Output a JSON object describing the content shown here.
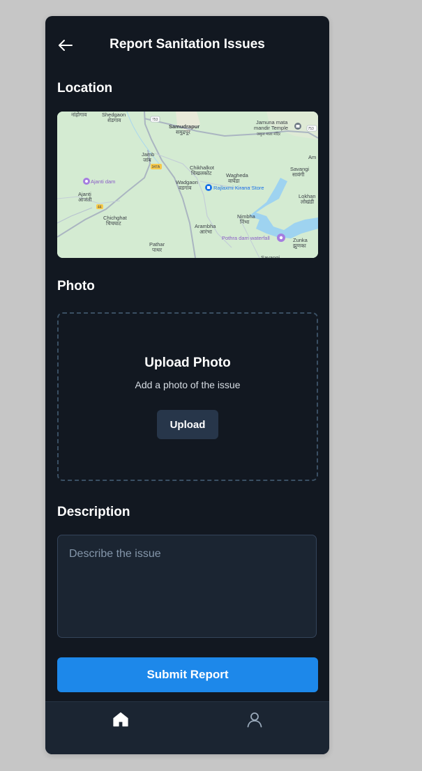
{
  "header": {
    "title": "Report Sanitation Issues",
    "back_icon": "arrow-left-icon"
  },
  "location": {
    "label": "Location",
    "map": {
      "places": [
        {
          "name": "Shedgaon",
          "local": "शेडगाव"
        },
        {
          "name": "Samudrapur",
          "local": "समुद्रपूर"
        },
        {
          "name": "Jamuna mata mandir Temple",
          "local": "जमुना माता मंदिर"
        },
        {
          "name": "Jamb",
          "local": "जांब"
        },
        {
          "name": "Ajanti dam"
        },
        {
          "name": "Ajanti",
          "local": "आजंती"
        },
        {
          "name": "Chikhalkot",
          "local": "चिखलकोट"
        },
        {
          "name": "Wagheda",
          "local": "वाघेडा"
        },
        {
          "name": "Wadgaon",
          "local": "वडगाव"
        },
        {
          "name": "Rajlaxmi Kirana Store"
        },
        {
          "name": "Savangi",
          "local": "सावंगी"
        },
        {
          "name": "Lokhan",
          "local": "लोखंडी"
        },
        {
          "name": "Chichghat",
          "local": "चिचघाट"
        },
        {
          "name": "Nimbha",
          "local": "निंभा"
        },
        {
          "name": "Arambha",
          "local": "आरंभा"
        },
        {
          "name": "Pothra dam waterfall"
        },
        {
          "name": "Zunka",
          "local": "झुणका"
        },
        {
          "name": "Pathar",
          "local": "पाथर"
        }
      ],
      "road_badges": [
        "753",
        "347A",
        "44"
      ]
    }
  },
  "photo": {
    "label": "Photo",
    "upload_title": "Upload Photo",
    "upload_subtitle": "Add a photo of the issue",
    "upload_button": "Upload"
  },
  "description": {
    "label": "Description",
    "placeholder": "Describe the issue",
    "value": ""
  },
  "submit": {
    "label": "Submit Report"
  },
  "nav": {
    "items": [
      {
        "icon": "home-icon",
        "active": true
      },
      {
        "icon": "user-icon",
        "active": false
      }
    ]
  },
  "colors": {
    "background": "#121821",
    "surface": "#1b2532",
    "accent": "#1d88ea",
    "upload_button": "#27364a"
  }
}
